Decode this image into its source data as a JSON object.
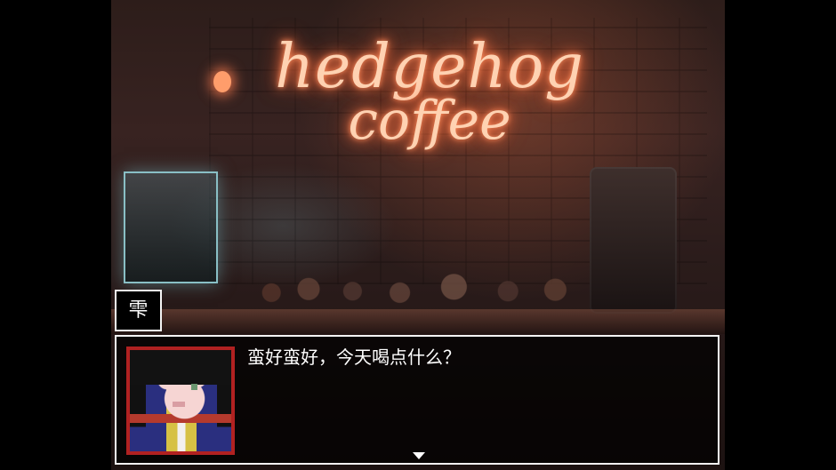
{
  "scene": {
    "sign_line_1": "hedgehog",
    "sign_line_2": "coffee"
  },
  "dialogue": {
    "speaker": "雫",
    "text": "蛮好蛮好，今天喝点什么？"
  },
  "icons": {
    "continue_arrow": "triangle-down-icon"
  },
  "colors": {
    "window_border": "#f4f4f4",
    "portrait_border": "#b12121",
    "neon_glow": "#ff7748"
  }
}
